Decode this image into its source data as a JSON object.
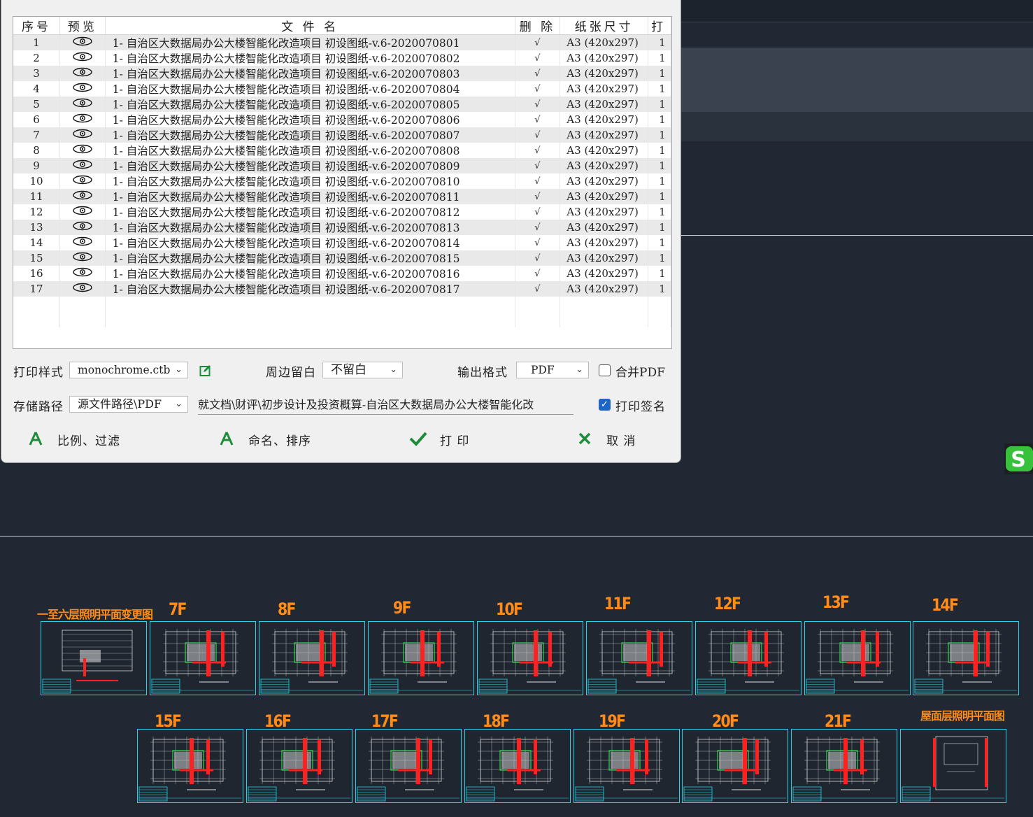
{
  "grid": {
    "headers": [
      "序号",
      "预览",
      "文 件 名",
      "删 除",
      "纸张尺寸",
      "打"
    ],
    "rows": [
      {
        "no": "1",
        "name": "1- 自治区大数据局办公大楼智能化改造项目 初设图纸-v.6-2020070801",
        "del": "√",
        "size": "A3 (420x297)",
        "print": "1"
      },
      {
        "no": "2",
        "name": "1- 自治区大数据局办公大楼智能化改造项目 初设图纸-v.6-2020070802",
        "del": "√",
        "size": "A3 (420x297)",
        "print": "1"
      },
      {
        "no": "3",
        "name": "1- 自治区大数据局办公大楼智能化改造项目 初设图纸-v.6-2020070803",
        "del": "√",
        "size": "A3 (420x297)",
        "print": "1"
      },
      {
        "no": "4",
        "name": "1- 自治区大数据局办公大楼智能化改造项目 初设图纸-v.6-2020070804",
        "del": "√",
        "size": "A3 (420x297)",
        "print": "1"
      },
      {
        "no": "5",
        "name": "1- 自治区大数据局办公大楼智能化改造项目 初设图纸-v.6-2020070805",
        "del": "√",
        "size": "A3 (420x297)",
        "print": "1"
      },
      {
        "no": "6",
        "name": "1- 自治区大数据局办公大楼智能化改造项目 初设图纸-v.6-2020070806",
        "del": "√",
        "size": "A3 (420x297)",
        "print": "1"
      },
      {
        "no": "7",
        "name": "1- 自治区大数据局办公大楼智能化改造项目 初设图纸-v.6-2020070807",
        "del": "√",
        "size": "A3 (420x297)",
        "print": "1"
      },
      {
        "no": "8",
        "name": "1- 自治区大数据局办公大楼智能化改造项目 初设图纸-v.6-2020070808",
        "del": "√",
        "size": "A3 (420x297)",
        "print": "1"
      },
      {
        "no": "9",
        "name": "1- 自治区大数据局办公大楼智能化改造项目 初设图纸-v.6-2020070809",
        "del": "√",
        "size": "A3 (420x297)",
        "print": "1"
      },
      {
        "no": "10",
        "name": "1- 自治区大数据局办公大楼智能化改造项目 初设图纸-v.6-2020070810",
        "del": "√",
        "size": "A3 (420x297)",
        "print": "1"
      },
      {
        "no": "11",
        "name": "1- 自治区大数据局办公大楼智能化改造项目 初设图纸-v.6-2020070811",
        "del": "√",
        "size": "A3 (420x297)",
        "print": "1"
      },
      {
        "no": "12",
        "name": "1- 自治区大数据局办公大楼智能化改造项目 初设图纸-v.6-2020070812",
        "del": "√",
        "size": "A3 (420x297)",
        "print": "1"
      },
      {
        "no": "13",
        "name": "1- 自治区大数据局办公大楼智能化改造项目 初设图纸-v.6-2020070813",
        "del": "√",
        "size": "A3 (420x297)",
        "print": "1"
      },
      {
        "no": "14",
        "name": "1- 自治区大数据局办公大楼智能化改造项目 初设图纸-v.6-2020070814",
        "del": "√",
        "size": "A3 (420x297)",
        "print": "1"
      },
      {
        "no": "15",
        "name": "1- 自治区大数据局办公大楼智能化改造项目 初设图纸-v.6-2020070815",
        "del": "√",
        "size": "A3 (420x297)",
        "print": "1"
      },
      {
        "no": "16",
        "name": "1- 自治区大数据局办公大楼智能化改造项目 初设图纸-v.6-2020070816",
        "del": "√",
        "size": "A3 (420x297)",
        "print": "1"
      },
      {
        "no": "17",
        "name": "1- 自治区大数据局办公大楼智能化改造项目 初设图纸-v.6-2020070817",
        "del": "√",
        "size": "A3 (420x297)",
        "print": "1"
      }
    ],
    "preview_icon": "eye-icon"
  },
  "options": {
    "plot_style_label": "打印样式",
    "plot_style_value": "monochrome.ctb",
    "margin_label": "周边留白",
    "margin_value": "不留白",
    "format_label": "输出格式",
    "format_value": "PDF",
    "merge_pdf_label": "合并PDF",
    "merge_pdf_checked": false,
    "save_path_label": "存储路径",
    "save_path_value": "源文件路径\\PDF",
    "save_path_text": "就文档\\财评\\初步设计及投资概算-自治区大数据局办公大楼智能化改",
    "print_signature_label": "打印签名",
    "print_signature_checked": true
  },
  "buttons": {
    "scale_filter": "比例、过滤",
    "naming_sort": "命名、排序",
    "print": "打 印",
    "cancel": "取 消"
  },
  "drawings": {
    "row1": [
      "一至六层照明平面变更图",
      "7F",
      "8F",
      "9F",
      "10F",
      "11F",
      "12F",
      "13F",
      "14F"
    ],
    "row2": [
      "15F",
      "16F",
      "17F",
      "18F",
      "19F",
      "20F",
      "21F",
      "屋面层照明平面图"
    ]
  },
  "colors": {
    "cad_background": "#212833",
    "sheet_border": "#2ad3e6",
    "floor_label": "#ff8c1a",
    "accent_green": "#1e8c3a",
    "checkbox_blue": "#1f65c9"
  }
}
